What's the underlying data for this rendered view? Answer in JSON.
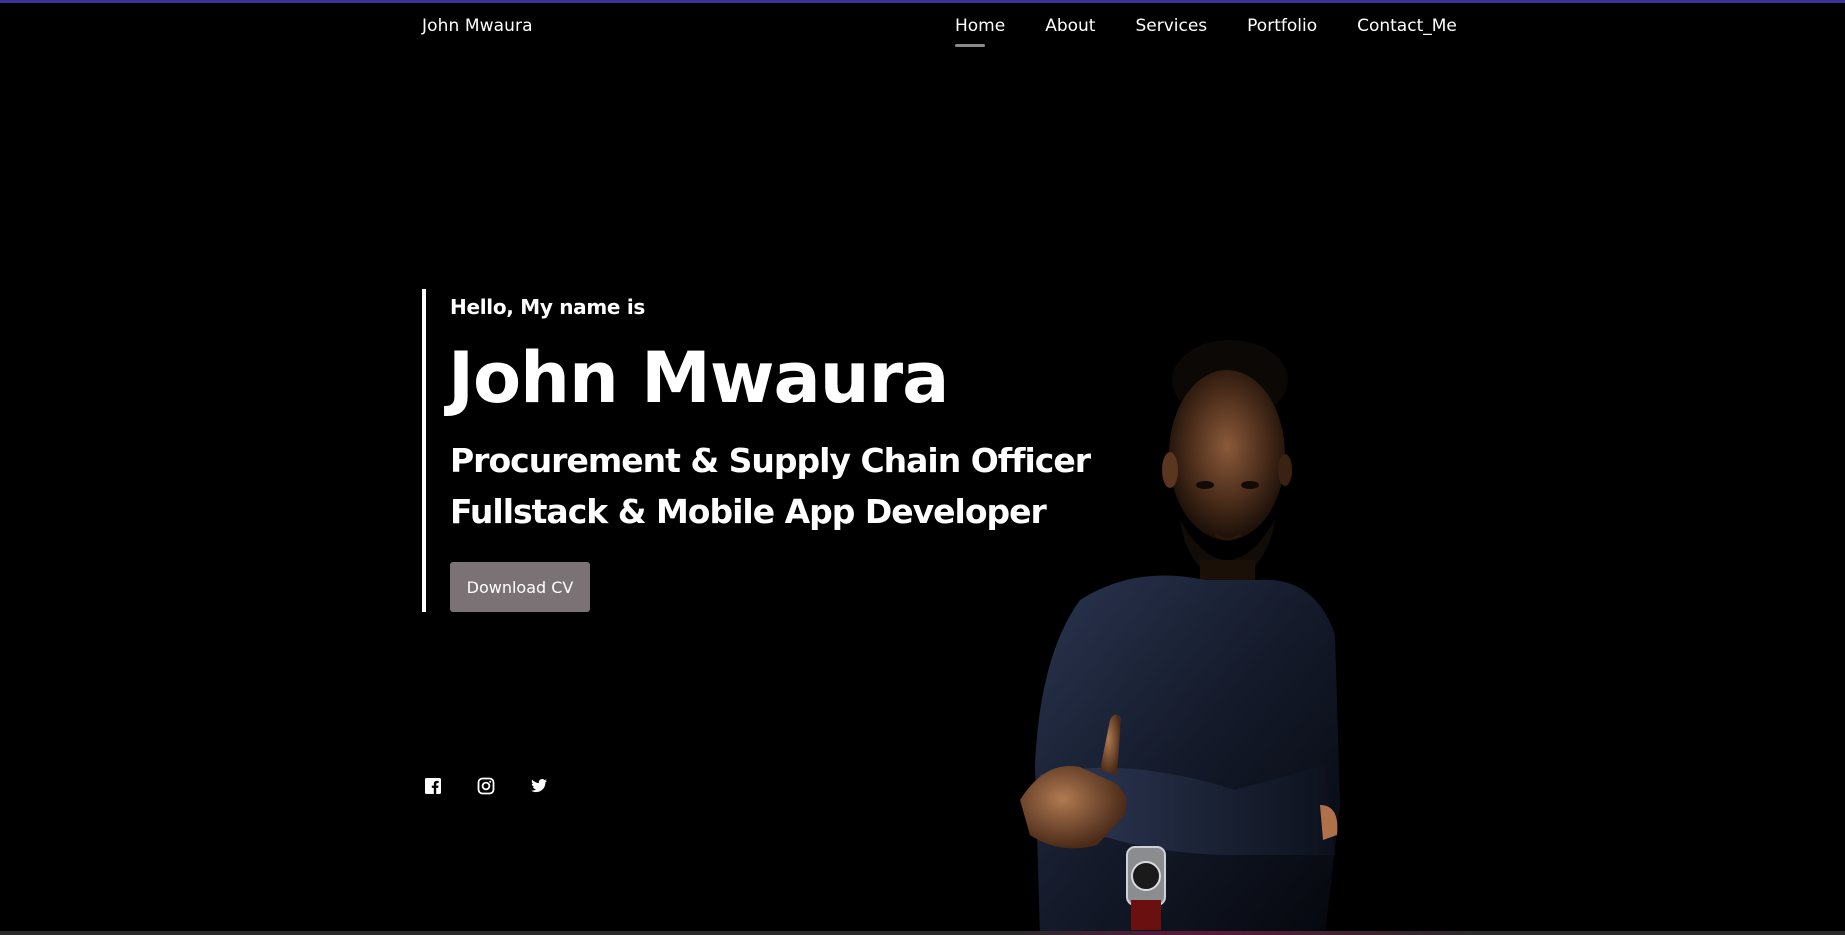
{
  "header": {
    "brand": "John Mwaura",
    "nav": [
      {
        "label": "Home",
        "active": true
      },
      {
        "label": "About",
        "active": false
      },
      {
        "label": "Services",
        "active": false
      },
      {
        "label": "Portfolio",
        "active": false
      },
      {
        "label": "Contact_Me",
        "active": false
      }
    ]
  },
  "hero": {
    "greeting": "Hello, My name is",
    "name": "John Mwaura",
    "roles": [
      "Procurement & Supply Chain Officer",
      "Fullstack & Mobile App Developer"
    ],
    "cta_label": "Download CV"
  },
  "socials": [
    {
      "icon": "facebook-icon"
    },
    {
      "icon": "instagram-icon"
    },
    {
      "icon": "twitter-icon"
    }
  ],
  "colors": {
    "background": "#000000",
    "text": "#ffffff",
    "button": "#7a7274",
    "top_strip": "#3b2f9a",
    "nav_underline": "#8a8a8a"
  }
}
